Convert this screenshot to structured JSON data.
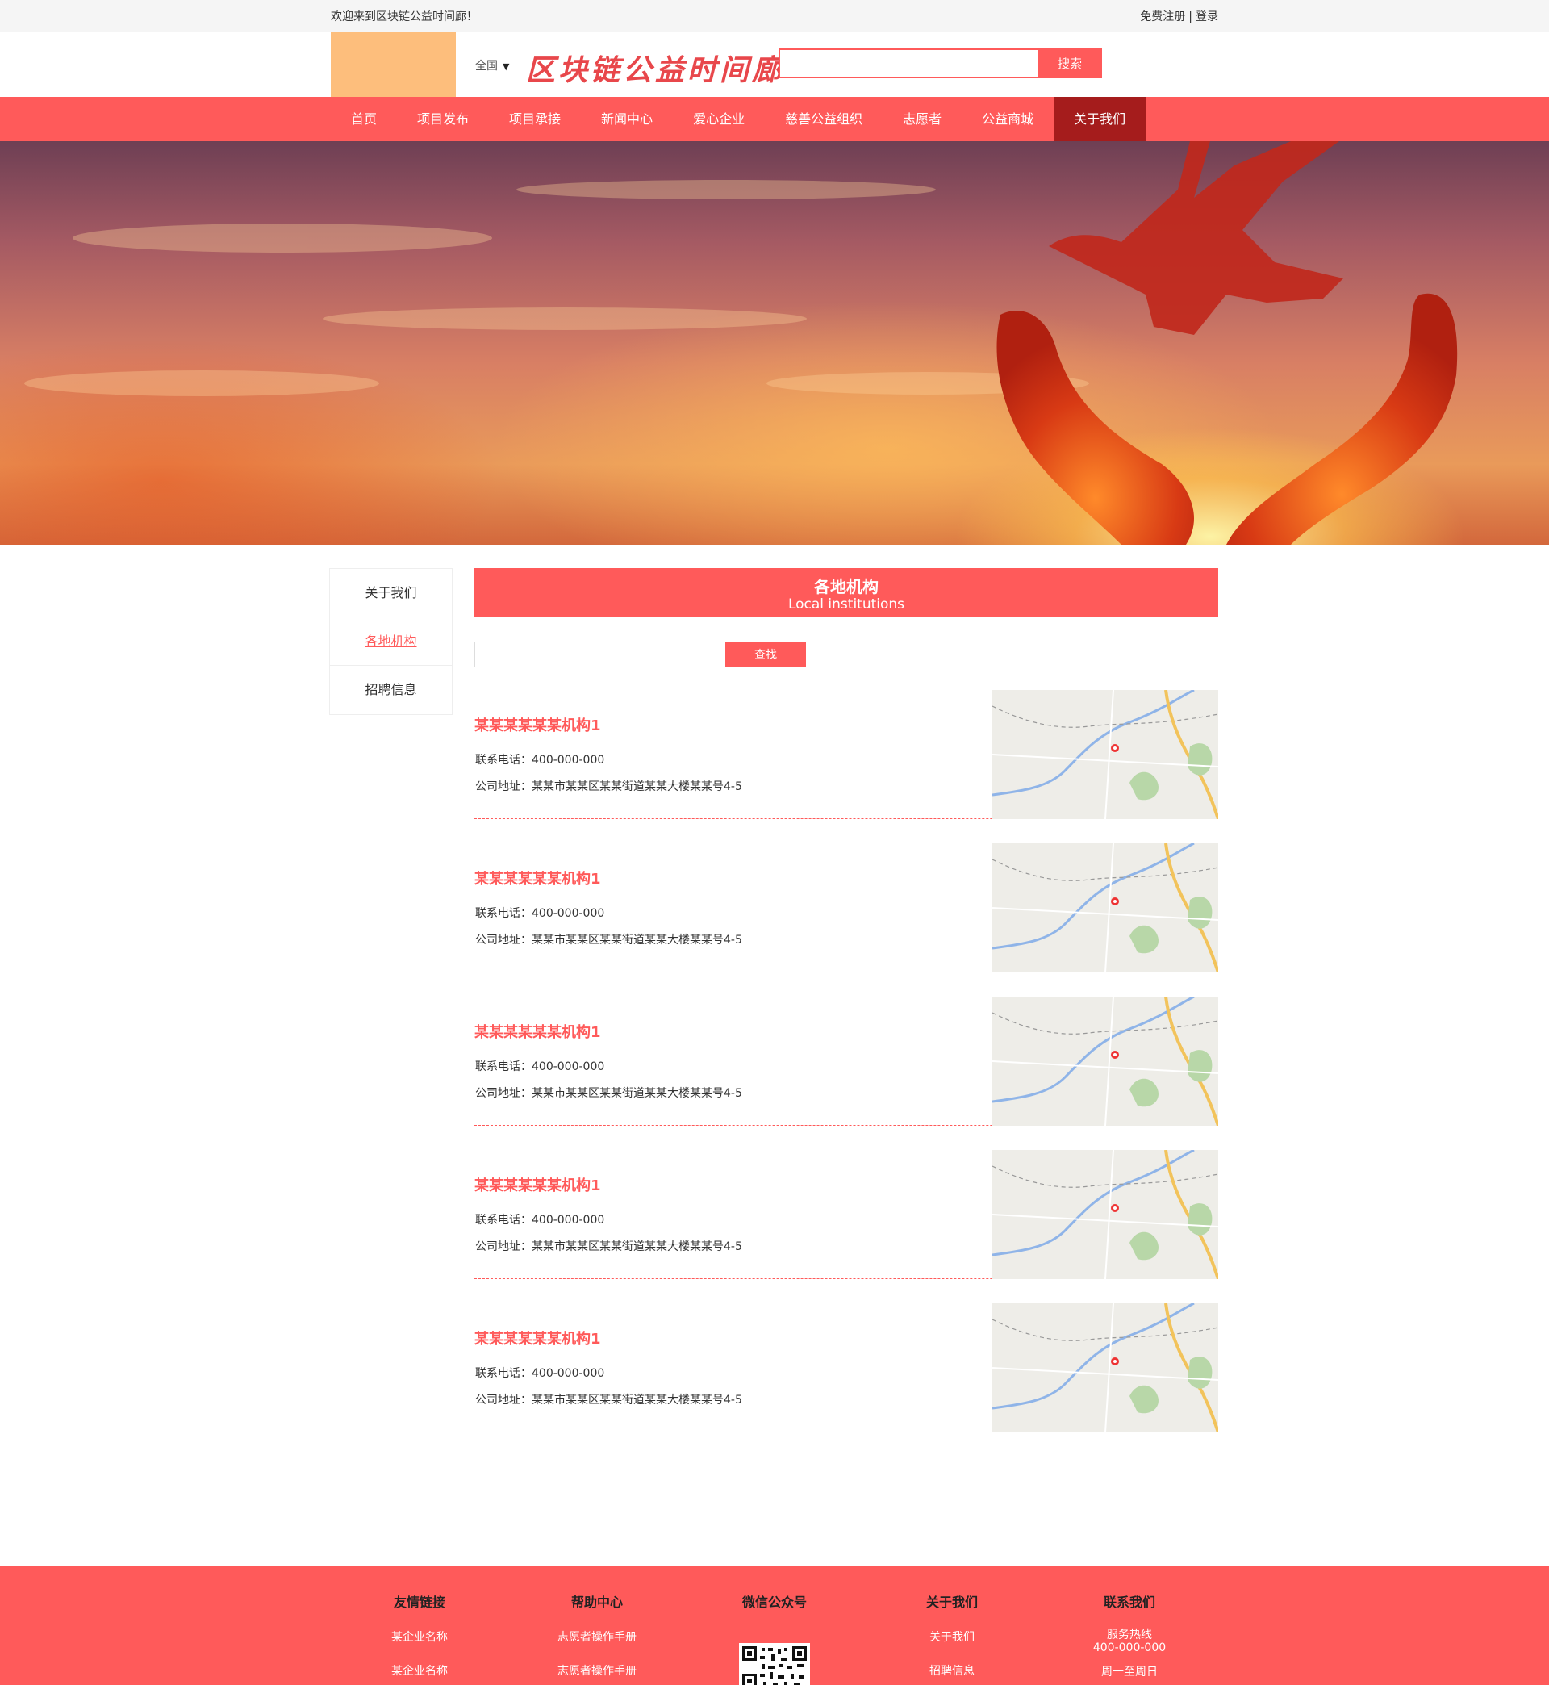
{
  "topbar": {
    "welcome": "欢迎来到区块链公益时间廊！",
    "register": "免费注册",
    "separator": "|",
    "login": "登录"
  },
  "header": {
    "region": "全国",
    "brand": "区块链公益时间廊",
    "search_placeholder": "",
    "search_button": "搜索"
  },
  "nav": {
    "items": [
      "首页",
      "项目发布",
      "项目承接",
      "新闻中心",
      "爱心企业",
      "慈善公益组织",
      "志愿者",
      "公益商城",
      "关于我们"
    ],
    "active_index": 8
  },
  "side_menu": {
    "items": [
      "关于我们",
      "各地机构",
      "招聘信息"
    ],
    "active_index": 1
  },
  "section": {
    "title_zh": "各地机构",
    "title_en": "Local institutions",
    "find_placeholder": "",
    "find_button": "查找"
  },
  "institutions": [
    {
      "name": "某某某某某某机构1",
      "phone": "联系电话：400-000-000",
      "address": "公司地址：某某市某某区某某街道某某大楼某某号4-5"
    },
    {
      "name": "某某某某某某机构1",
      "phone": "联系电话：400-000-000",
      "address": "公司地址：某某市某某区某某街道某某大楼某某号4-5"
    },
    {
      "name": "某某某某某某机构1",
      "phone": "联系电话：400-000-000",
      "address": "公司地址：某某市某某区某某街道某某大楼某某号4-5"
    },
    {
      "name": "某某某某某某机构1",
      "phone": "联系电话：400-000-000",
      "address": "公司地址：某某市某某区某某街道某某大楼某某号4-5"
    },
    {
      "name": "某某某某某某机构1",
      "phone": "联系电话：400-000-000",
      "address": "公司地址：某某市某某区某某街道某某大楼某某号4-5"
    }
  ],
  "footer": {
    "links": {
      "title": "友情链接",
      "items": [
        "某企业名称",
        "某企业名称"
      ]
    },
    "help": {
      "title": "帮助中心",
      "items": [
        "志愿者操作手册",
        "志愿者操作手册"
      ]
    },
    "wechat": {
      "title": "微信公众号"
    },
    "about": {
      "title": "关于我们",
      "items": [
        "关于我们",
        "招聘信息"
      ]
    },
    "contact": {
      "title": "联系我们",
      "hotline_label": "服务热线",
      "hotline": "400-000-000",
      "hours": "周一至周日"
    }
  },
  "colors": {
    "accent": "#ff5a5a",
    "nav_active": "#a51c1c",
    "logo_placeholder": "#fdbe7c"
  }
}
